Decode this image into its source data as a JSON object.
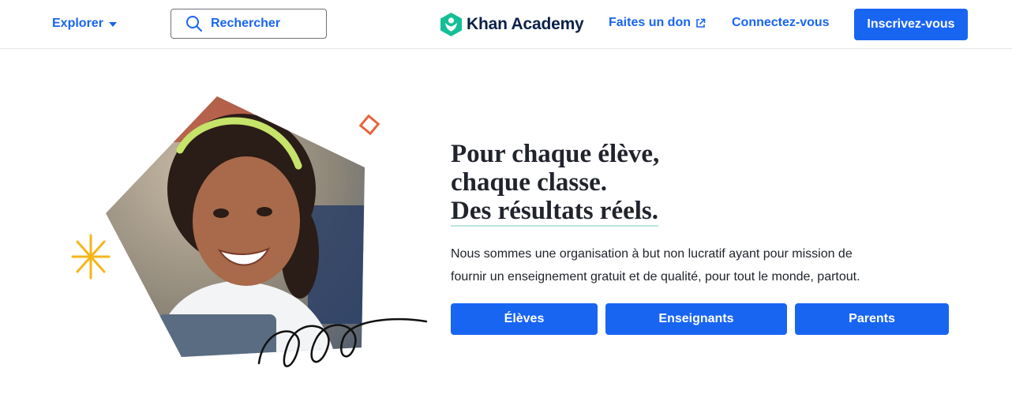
{
  "header": {
    "explore_label": "Explorer",
    "search_label": "Rechercher",
    "logo_text": "Khan Academy",
    "donate_label": "Faites un don",
    "login_label": "Connectez-vous",
    "signup_label": "Inscrivez-vous"
  },
  "hero": {
    "headline": [
      "Pour chaque élève,",
      "chaque classe.",
      "Des résultats réels."
    ],
    "mission": "Nous sommes une organisation à but non lucratif ayant pour mission de fournir un enseignement gratuit et de qualité, pour tout le monde, partout.",
    "buttons": [
      {
        "label": "Élèves"
      },
      {
        "label": "Enseignants"
      },
      {
        "label": "Parents"
      }
    ]
  },
  "colors": {
    "brand_blue": "#1865f2",
    "logo_green": "#14bf96",
    "logo_navy": "#0b2149",
    "accent_orange": "#e8643f",
    "accent_yellow": "#f5b61a"
  },
  "icons": [
    "chevron-down-icon",
    "search-icon",
    "khan-logo-icon",
    "external-link-icon",
    "sparkle-icon",
    "diamond-outline-icon",
    "squiggle-icon"
  ]
}
